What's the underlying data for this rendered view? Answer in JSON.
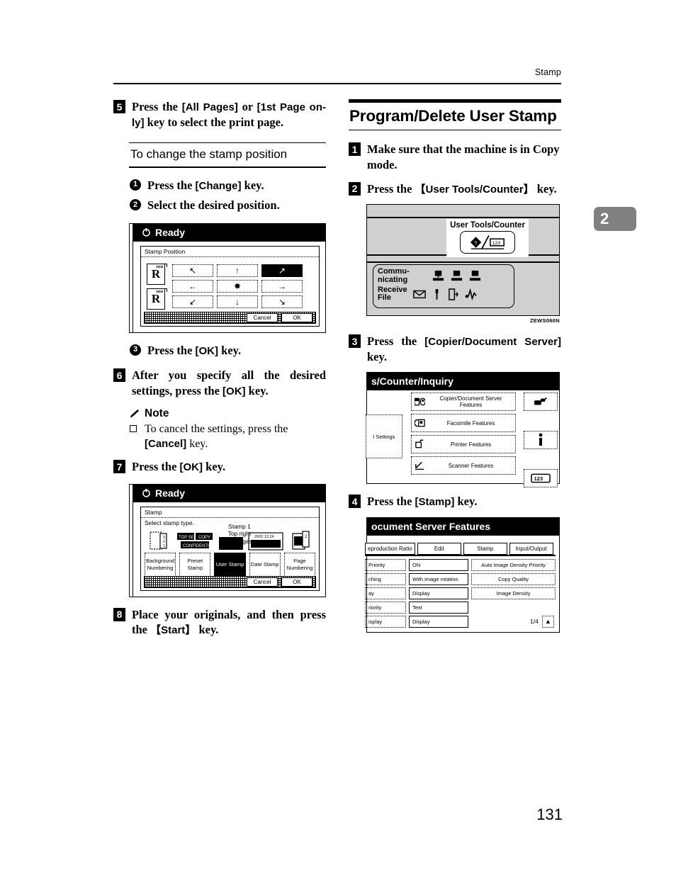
{
  "running_head": "Stamp",
  "page_number": "131",
  "chapter_tab": "2",
  "left_column": {
    "step5": {
      "num": "5",
      "text_a": "Press the ",
      "key_a": "[All Pages]",
      "text_b": " or ",
      "key_b": "[1st Page on-ly]",
      "text_c": " key to select the print page."
    },
    "subheading": "To change the stamp position",
    "sub1": {
      "marker": "1",
      "text_a": "Press the ",
      "key": "[Change]",
      "text_b": " key."
    },
    "sub2": {
      "marker": "2",
      "text": "Select the desired position."
    },
    "sub3": {
      "marker": "3",
      "text_a": "Press the ",
      "key": "[OK]",
      "text_b": " key."
    },
    "step6": {
      "num": "6",
      "text_a": "After you specify all the desired settings, press the ",
      "key": "[OK]",
      "text_b": " key."
    },
    "note": {
      "title": "Note",
      "item_a": "To cancel the settings, press the ",
      "item_key": "[Cancel]",
      "item_b": " key."
    },
    "step7": {
      "num": "7",
      "text_a": "Press the ",
      "key": "[OK]",
      "text_b": " key."
    },
    "step8": {
      "num": "8",
      "text_a": "Place your originals, and then press the ",
      "key": "【Start】",
      "text_b": " key."
    }
  },
  "right_column": {
    "section_title": "Program/Delete User Stamp",
    "step1": {
      "num": "1",
      "text": "Make sure that the machine is in Copy mode."
    },
    "step2": {
      "num": "2",
      "text_a": "Press the ",
      "key": "【User Tools/Counter】",
      "text_b": " key."
    },
    "step3": {
      "num": "3",
      "text_a": "Press the ",
      "key": "[Copier/Document Server]",
      "text_b": " key."
    },
    "step4": {
      "num": "4",
      "text_a": "Press the ",
      "key": "[Stamp]",
      "text_b": " key."
    }
  },
  "screen_stamp_position": {
    "status": "Ready",
    "panel_title": "Stamp Position",
    "arrows": [
      {
        "glyph": "↖",
        "name": "up-left",
        "selected": false
      },
      {
        "glyph": "↑",
        "name": "up",
        "selected": false
      },
      {
        "glyph": "↗",
        "name": "up-right",
        "selected": true
      },
      {
        "glyph": "←",
        "name": "left",
        "selected": false
      },
      {
        "glyph": "✸",
        "name": "center",
        "selected": false
      },
      {
        "glyph": "→",
        "name": "right",
        "selected": false
      },
      {
        "glyph": "↙",
        "name": "down-left",
        "selected": false
      },
      {
        "glyph": "↓",
        "name": "down",
        "selected": false
      },
      {
        "glyph": "↘",
        "name": "down-right",
        "selected": false
      }
    ],
    "thumb_letter": "R",
    "cancel_label": "Cancel",
    "ok_label": "OK"
  },
  "screen_stamp_type": {
    "status": "Ready",
    "panel_title": "Stamp",
    "instruction": "Select stamp type.",
    "summary_line1": "Stamp  1",
    "summary_line2": "Top right",
    "summary_line3": "All Pages",
    "date_sample": "2002.12.24",
    "preset_sample_1": "TOP SECRET",
    "preset_sample_2": "COPY",
    "preset_sample_3": "CONFIDENTIAL",
    "buttons": [
      {
        "label1": "Background",
        "label2": "Numbering",
        "selected": false
      },
      {
        "label1": "Preset",
        "label2": "Stamp",
        "selected": false
      },
      {
        "label1": "User Stamp",
        "label2": "",
        "selected": true
      },
      {
        "label1": "Date Stamp",
        "label2": "",
        "selected": false
      },
      {
        "label1": "Page",
        "label2": "Numbering",
        "selected": false
      }
    ],
    "cancel_label": "Cancel",
    "ok_label": "OK"
  },
  "figure_control_panel": {
    "callout_label": "User Tools/Counter",
    "key_glyph_left": "◇",
    "key_glyph_right": "123",
    "status_communicating": "Commu-\nnicating",
    "status_communicating_l1": "Commu-",
    "status_communicating_l2": "nicating",
    "status_receive_l1": "Receive",
    "status_receive_l2": "File",
    "figure_code": "ZEWS060N"
  },
  "screen_user_tools": {
    "title": "s/Counter/Inquiry",
    "left_button": "l Settings",
    "menu_items": [
      {
        "label1": "Copier/Document Server",
        "label2": "Features",
        "icon": "copier-icon"
      },
      {
        "label1": "Facsimile Features",
        "label2": "",
        "icon": "fax-icon"
      },
      {
        "label1": "Printer Features",
        "label2": "",
        "icon": "printer-icon"
      },
      {
        "label1": "Scanner Features",
        "label2": "",
        "icon": "scanner-icon"
      }
    ],
    "side_buttons": [
      {
        "icon": "network-icon"
      },
      {
        "icon": "info-icon"
      },
      {
        "icon": "counter-icon",
        "label": "123"
      }
    ]
  },
  "screen_features": {
    "title": "ocument Server Features",
    "tabs": [
      {
        "label": "eproduction Ratio",
        "active": true
      },
      {
        "label": "Edit",
        "active": false
      },
      {
        "label": "Stamp",
        "active": false
      },
      {
        "label": "Input/Output",
        "active": false
      }
    ],
    "rows": [
      {
        "name": "Priority",
        "value": "ON",
        "action": "Auto Image Density Priority"
      },
      {
        "name": "ching",
        "value": "With image rotation",
        "action": "Copy Quality"
      },
      {
        "name": "ay",
        "value": "Display",
        "action": "Image Density"
      },
      {
        "name": "riority",
        "value": "Text",
        "action": ""
      },
      {
        "name": "isplay",
        "value": "Display",
        "action": ""
      }
    ],
    "page_indicator": "1/4"
  }
}
